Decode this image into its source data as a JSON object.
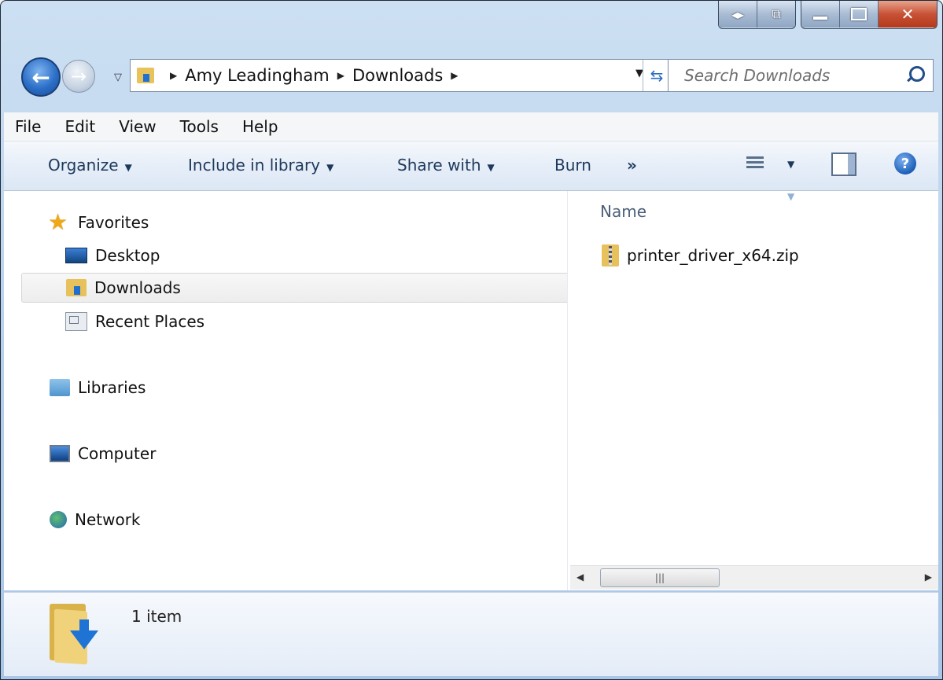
{
  "address": {
    "breadcrumbs": [
      "Amy Leadingham",
      "Downloads"
    ],
    "search_placeholder": "Search Downloads"
  },
  "menu": [
    "File",
    "Edit",
    "View",
    "Tools",
    "Help"
  ],
  "toolbar": {
    "organize": "Organize",
    "include_in_library": "Include in library",
    "share_with": "Share with",
    "burn": "Burn",
    "more": "»"
  },
  "nav": {
    "favorites": "Favorites",
    "desktop": "Desktop",
    "downloads": "Downloads",
    "recent_places": "Recent Places",
    "libraries": "Libraries",
    "computer": "Computer",
    "network": "Network"
  },
  "files": {
    "column_name": "Name",
    "items": [
      {
        "name": "printer_driver_x64.zip",
        "icon": "zip-folder-icon"
      }
    ]
  },
  "details": {
    "item_count": "1 item"
  },
  "colors": {
    "selection_bg": "#ededed",
    "command_text": "#1e395b",
    "accent": "#1f73d4"
  }
}
